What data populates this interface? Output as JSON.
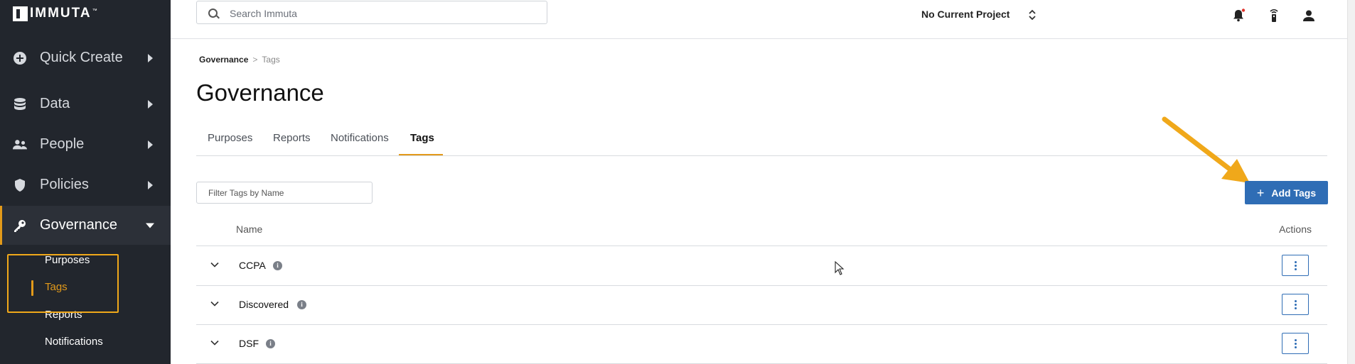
{
  "app": {
    "logo_text": "IMMUTA",
    "logo_tm": "™"
  },
  "sidebar": {
    "items": [
      {
        "label": "Quick Create",
        "icon": "plus-circle-icon"
      },
      {
        "label": "Data",
        "icon": "database-icon"
      },
      {
        "label": "People",
        "icon": "people-icon"
      },
      {
        "label": "Policies",
        "icon": "shield-icon"
      },
      {
        "label": "Governance",
        "icon": "key-icon",
        "active": true
      }
    ],
    "governance_sub": [
      {
        "label": "Purposes"
      },
      {
        "label": "Tags",
        "active": true
      },
      {
        "label": "Reports"
      },
      {
        "label": "Notifications"
      }
    ]
  },
  "topbar": {
    "search_placeholder": "Search Immuta",
    "project_label": "No Current Project",
    "icons": [
      "notifications-bell-icon",
      "remote-icon",
      "user-icon"
    ]
  },
  "breadcrumb": {
    "parent": "Governance",
    "separator": ">",
    "current": "Tags"
  },
  "page": {
    "title": "Governance"
  },
  "tabs": [
    {
      "label": "Purposes"
    },
    {
      "label": "Reports"
    },
    {
      "label": "Notifications"
    },
    {
      "label": "Tags",
      "active": true
    }
  ],
  "filter": {
    "placeholder": "Filter Tags by Name"
  },
  "add_button": {
    "label": "Add Tags"
  },
  "table": {
    "headers": {
      "name": "Name",
      "actions": "Actions"
    },
    "rows": [
      {
        "name": "CCPA"
      },
      {
        "name": "Discovered"
      },
      {
        "name": "DSF"
      }
    ]
  },
  "colors": {
    "accent": "#e39a1a",
    "primary": "#2f6db5",
    "sidebar_bg": "#22262d",
    "annotation": "#f0a81a"
  }
}
